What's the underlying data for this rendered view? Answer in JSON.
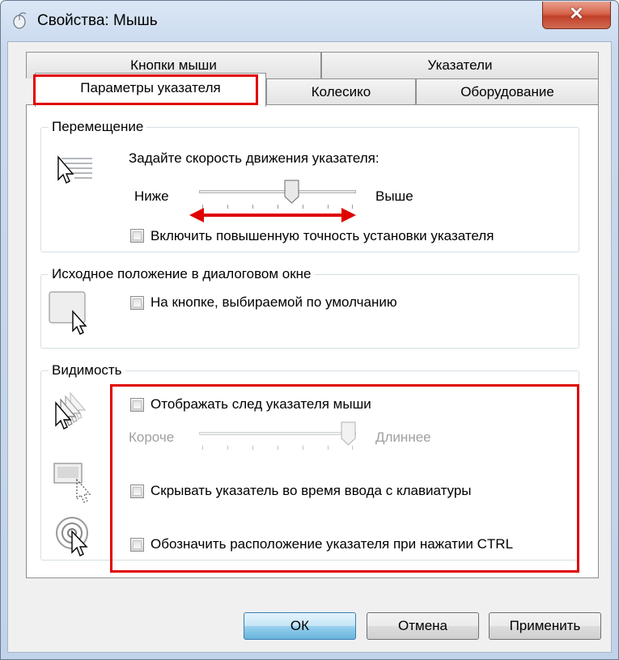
{
  "window": {
    "title": "Свойства: Мышь",
    "close_label": "✕"
  },
  "tabs": {
    "back_row": [
      "Кнопки мыши",
      "Указатели"
    ],
    "front_row": [
      "Параметры указателя",
      "Колесико",
      "Оборудование"
    ],
    "active": "Параметры указателя"
  },
  "motion": {
    "group_title": "Перемещение",
    "prompt": "Задайте скорость движения указателя:",
    "slow_label": "Ниже",
    "fast_label": "Выше",
    "speed_level": 0.6,
    "precision_label": "Включить повышенную точность установки указателя",
    "precision_checked": false
  },
  "snap_to": {
    "group_title": "Исходное положение в диалоговом окне",
    "default_button_label": "На кнопке, выбираемой по умолчанию",
    "checked": false
  },
  "visibility": {
    "group_title": "Видимость",
    "trails_label": "Отображать след указателя мыши",
    "trails_checked": false,
    "trails_short_label": "Короче",
    "trails_long_label": "Длиннее",
    "trails_level": 1.0,
    "hide_typing_label": "Скрывать указатель во время ввода с клавиатуры",
    "hide_typing_checked": false,
    "show_ctrl_label": "Обозначить расположение указателя при нажатии CTRL",
    "show_ctrl_checked": false
  },
  "buttons": {
    "ok": "ОК",
    "cancel": "Отмена",
    "apply": "Применить"
  },
  "annotation_color": "#e00000",
  "icons": [
    "mouse-icon",
    "close-icon",
    "pointer-speed-icon",
    "snap-to-icon",
    "pointer-trails-icon",
    "hide-pointer-icon",
    "ctrl-locate-icon",
    "double-arrow-icon"
  ]
}
